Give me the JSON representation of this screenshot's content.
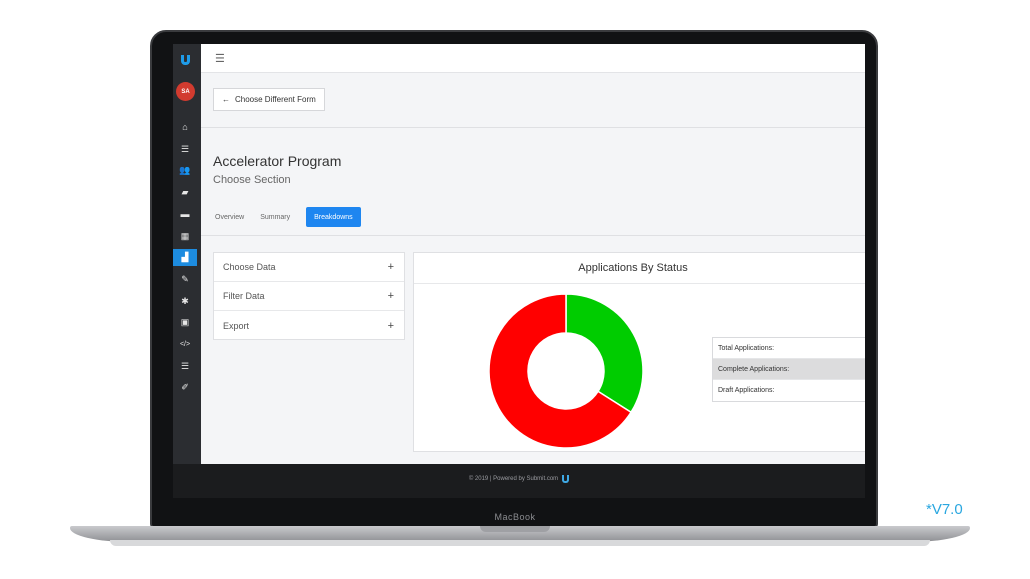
{
  "version_label": "*V7.0",
  "laptop_brand": "MacBook",
  "footer": {
    "text": "© 2019 | Powered by Submit.com"
  },
  "sidebar": {
    "avatar_initials": "SA",
    "items": [
      {
        "icon": "home-icon",
        "glyph": "⌂"
      },
      {
        "icon": "list-icon",
        "glyph": "☰"
      },
      {
        "icon": "users-icon",
        "glyph": "👥"
      },
      {
        "icon": "folder-icon",
        "glyph": "▰"
      },
      {
        "icon": "inbox-icon",
        "glyph": "▬"
      },
      {
        "icon": "calendar-icon",
        "glyph": "▦"
      },
      {
        "icon": "chart-icon",
        "glyph": "▟",
        "active": true
      },
      {
        "icon": "brush-icon",
        "glyph": "✎"
      },
      {
        "icon": "gear-icon",
        "glyph": "✱"
      },
      {
        "icon": "video-icon",
        "glyph": "▣"
      },
      {
        "icon": "code-icon",
        "glyph": "</>"
      },
      {
        "icon": "list-alt-icon",
        "glyph": "☰"
      },
      {
        "icon": "edit-icon",
        "glyph": "✐"
      }
    ]
  },
  "topbar": {
    "menu_icon": "☰"
  },
  "back_button": {
    "label": "Choose Different Form",
    "icon": "arrow-left-icon"
  },
  "page": {
    "title": "Accelerator Program",
    "subtitle": "Choose Section"
  },
  "tabs": [
    {
      "label": "Overview",
      "active": false
    },
    {
      "label": "Summary",
      "active": false
    },
    {
      "label": "Breakdowns",
      "active": true
    }
  ],
  "accordion": [
    {
      "label": "Choose Data",
      "icon": "+"
    },
    {
      "label": "Filter Data",
      "icon": "+"
    },
    {
      "label": "Export",
      "icon": "+"
    }
  ],
  "chart_panel": {
    "title": "Applications By Status"
  },
  "chart_data": {
    "type": "pie",
    "title": "Applications By Status",
    "donut": true,
    "slices": [
      {
        "label": "Complete Applications",
        "value": 34,
        "color": "#00cc00"
      },
      {
        "label": "Draft Applications",
        "value": 66,
        "color": "#ff0000"
      }
    ]
  },
  "legend": [
    {
      "label": "Total Applications:",
      "highlight": false
    },
    {
      "label": "Complete Applications:",
      "highlight": true
    },
    {
      "label": "Draft Applications:",
      "highlight": false
    }
  ]
}
